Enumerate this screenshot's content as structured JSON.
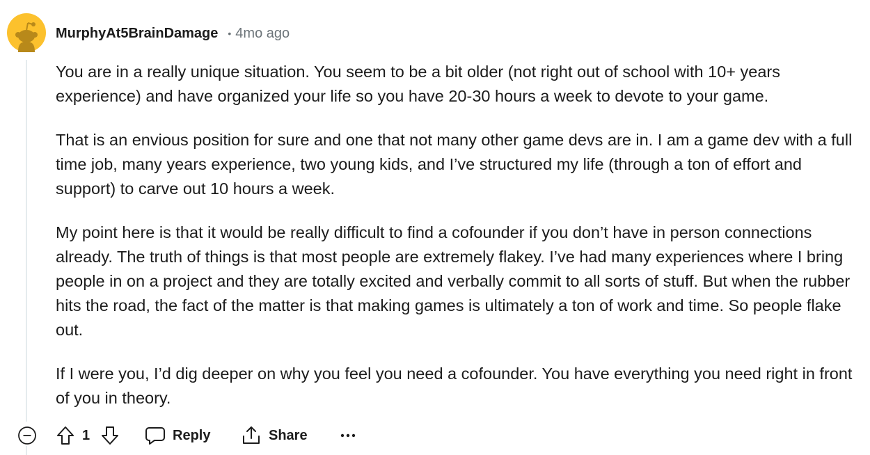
{
  "comment": {
    "author": "MurphyAt5BrainDamage",
    "separator": "•",
    "timestamp": "4mo ago",
    "paragraphs": [
      "You are in a really unique situation. You seem to be a bit older (not right out of school with 10+ years experience) and have organized your life so you have 20-30 hours a week to devote to your game.",
      "That is an envious position for sure and one that not many other game devs are in. I am a game dev with a full time job, many years experience, two young kids, and I’ve structured my life (through a ton of effort and support) to carve out 10 hours a week.",
      "My point here is that it would be really difficult to find a cofounder if you don’t have in person connections already. The truth of things is that most people are extremely flakey. I’ve had many experiences where I bring people in on a project and they are totally excited and verbally commit to all sorts of stuff. But when the rubber hits the road, the fact of the matter is that making games is ultimately a ton of work and time. So people flake out.",
      "If I were you, I’d dig deeper on why you feel you need a cofounder. You have everything you need right in front of you in theory."
    ]
  },
  "actions": {
    "vote_count": "1",
    "reply_label": "Reply",
    "share_label": "Share",
    "more_label": "•••"
  },
  "icons": {
    "avatar": "snoo-avatar",
    "collapse": "collapse-minus-icon",
    "upvote": "upvote-arrow-icon",
    "downvote": "downvote-arrow-icon",
    "reply": "speech-bubble-icon",
    "share": "share-upload-icon",
    "more": "overflow-dots-icon"
  },
  "colors": {
    "avatar_bg": "#fcc12d",
    "avatar_figure": "#b8891a",
    "text": "#1c1c1c",
    "meta": "#6b7378",
    "thread_line": "#e5ebee"
  }
}
